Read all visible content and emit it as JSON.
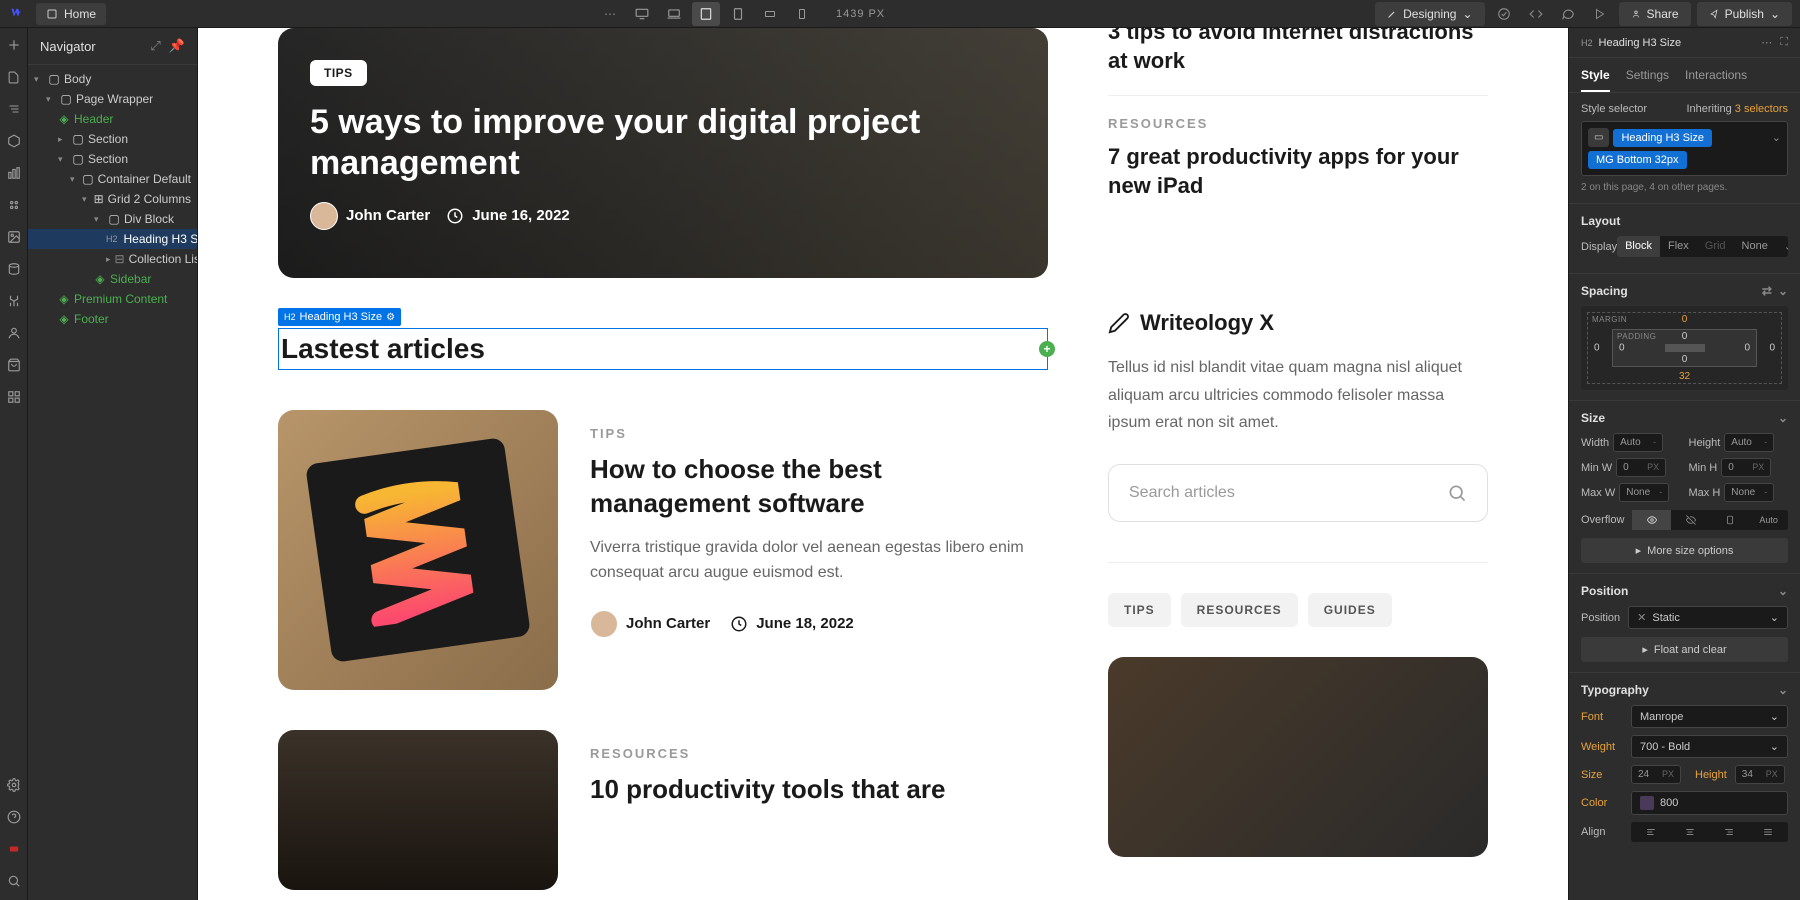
{
  "topbar": {
    "home": "Home",
    "width": "1439",
    "unit": "PX",
    "designing": "Designing",
    "share": "Share",
    "publish": "Publish"
  },
  "navigator": {
    "title": "Navigator",
    "items": {
      "body": "Body",
      "pageWrapper": "Page Wrapper",
      "header": "Header",
      "section1": "Section",
      "section2": "Section",
      "container": "Container Default",
      "grid2": "Grid 2 Columns",
      "divBlock": "Div Block",
      "headingH3": "Heading H3 S",
      "collectionList": "Collection Lis",
      "sidebar": "Sidebar",
      "premium": "Premium Content",
      "footer": "Footer"
    }
  },
  "canvas": {
    "hero": {
      "tag": "TIPS",
      "title": "5 ways to improve your digital project management",
      "author": "John Carter",
      "date": "June 16, 2022"
    },
    "sideArticles": [
      {
        "cat": "",
        "title": "3 tips to avoid internet distractions at work"
      },
      {
        "cat": "RESOURCES",
        "title": "7 great productivity apps for your new iPad"
      }
    ],
    "selectedBadge": "Heading H3 Size",
    "selectedBadgePrefix": "H2",
    "latestTitle": "Lastest articles",
    "article1": {
      "cat": "TIPS",
      "title": "How to choose the best management software",
      "desc": "Viverra tristique gravida dolor vel aenean egestas libero enim consequat arcu augue euismod est.",
      "author": "John Carter",
      "date": "June 18, 2022"
    },
    "article2": {
      "cat": "RESOURCES",
      "title": "10 productivity tools that are"
    },
    "brand": {
      "name": "Writeology X",
      "desc": "Tellus id nisl blandit vitae quam magna nisl aliquet aliquam arcu ultricies commodo felisoler massa ipsum erat non sit amet.",
      "searchPlaceholder": "Search articles"
    },
    "pills": {
      "tips": "TIPS",
      "resources": "RESOURCES",
      "guides": "GUIDES"
    }
  },
  "style": {
    "headerPrefix": "H2",
    "headerTitle": "Heading H3 Size",
    "tabs": {
      "style": "Style",
      "settings": "Settings",
      "interactions": "Interactions"
    },
    "selectorLabel": "Style selector",
    "inheriting": "Inheriting",
    "inheritCount": "3 selectors",
    "chips": {
      "main": "Heading H3 Size",
      "combo": "MG Bottom 32px"
    },
    "countText": "2 on this page, 4 on other pages.",
    "layout": {
      "title": "Layout",
      "displayLabel": "Display",
      "block": "Block",
      "flex": "Flex",
      "grid": "Grid",
      "none": "None"
    },
    "spacing": {
      "title": "Spacing",
      "marginLabel": "MARGIN",
      "paddingLabel": "PADDING",
      "mTop": "0",
      "mRight": "0",
      "mBottom": "32",
      "mLeft": "0",
      "pTop": "0",
      "pRight": "0",
      "pBottom": "0",
      "pLeft": "0"
    },
    "size": {
      "title": "Size",
      "widthLabel": "Width",
      "width": "Auto",
      "heightLabel": "Height",
      "height": "Auto",
      "minWLabel": "Min W",
      "minW": "0",
      "minHLabel": "Min H",
      "minH": "0",
      "maxWLabel": "Max W",
      "maxW": "None",
      "maxHLabel": "Max H",
      "maxH": "None",
      "overflowLabel": "Overflow",
      "autoOpt": "Auto",
      "moreSize": "More size options",
      "pxUnit": "PX",
      "dashUnit": "-"
    },
    "position": {
      "title": "Position",
      "posLabel": "Position",
      "posValue": "Static",
      "floatClear": "Float and clear"
    },
    "typo": {
      "title": "Typography",
      "fontLabel": "Font",
      "font": "Manrope",
      "weightLabel": "Weight",
      "weight": "700 - Bold",
      "sizeLabel": "Size",
      "size": "24",
      "heightLabel": "Height",
      "height": "34",
      "colorLabel": "Color",
      "color": "800",
      "alignLabel": "Align",
      "px": "PX"
    }
  }
}
